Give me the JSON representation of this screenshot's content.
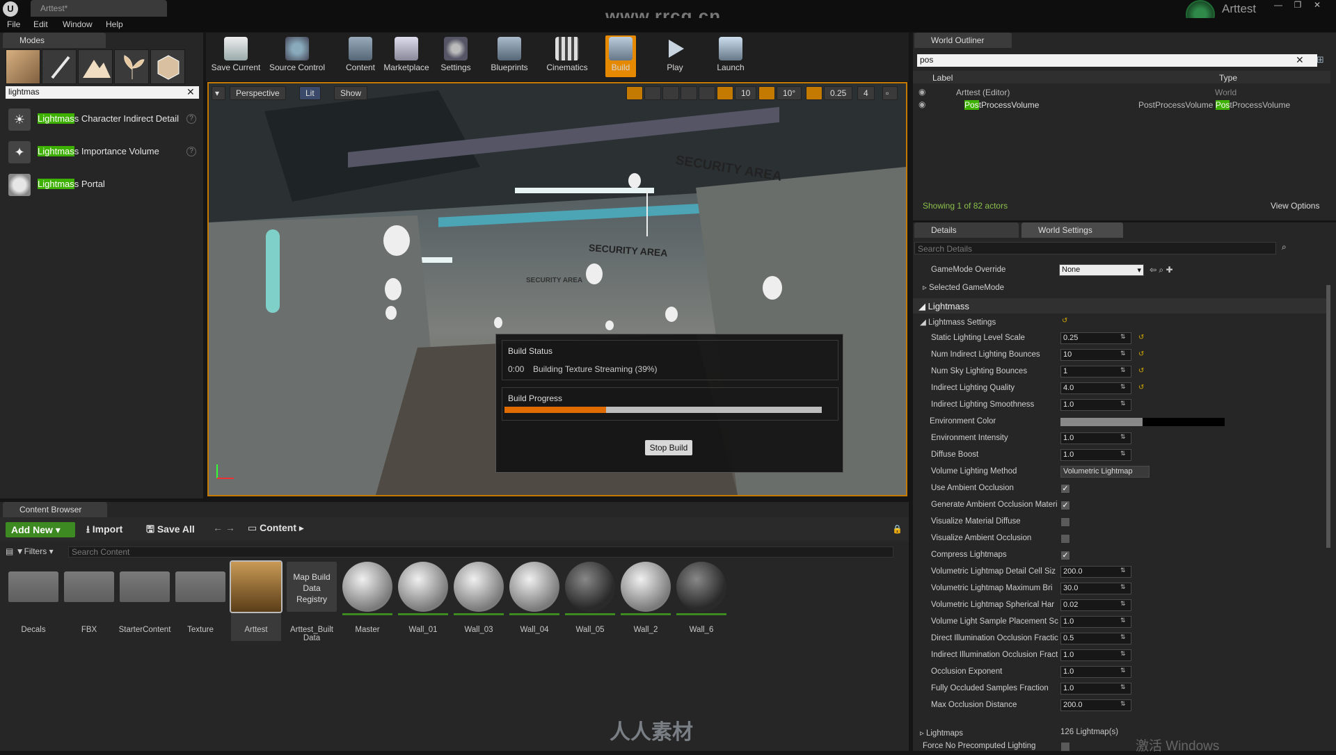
{
  "title_bar": {
    "tab_title": "Arttest*",
    "watermark_url": "www.rrcg.cn",
    "project_name": "Arttest"
  },
  "menu": [
    "File",
    "Edit",
    "Window",
    "Help"
  ],
  "modes": {
    "tab": "Modes",
    "search_value": "lightmas",
    "items": [
      {
        "match": "Lightmas",
        "rest": "s Character Indirect Detail"
      },
      {
        "match": "Lightmas",
        "rest": "s Importance Volume"
      },
      {
        "match": "Lightmas",
        "rest": "s Portal"
      }
    ]
  },
  "toolbar": {
    "buttons": [
      "Save Current",
      "Source Control",
      "Content",
      "Marketplace",
      "Settings",
      "Blueprints",
      "Cinematics",
      "Build",
      "Play",
      "Launch"
    ]
  },
  "viewport": {
    "perspective": "Perspective",
    "lit": "Lit",
    "show": "Show",
    "grid_snap": "10",
    "rot_snap": "10°",
    "scale_snap": "0.25",
    "cam_speed": "4",
    "signs": [
      "SECURITY AREA",
      "SECURITY AREA",
      "SECURITY AREA"
    ]
  },
  "build": {
    "status_title": "Build Status",
    "time": "0:00",
    "status_text": "Building Texture Streaming (39%)",
    "progress_title": "Build Progress",
    "progress": 0.32,
    "stop_label": "Stop Build"
  },
  "outliner": {
    "tab": "World Outliner",
    "search_value": "pos",
    "col_label": "Label",
    "col_type": "Type",
    "rows": [
      {
        "label": "Arttest (Editor)",
        "type": "World"
      },
      {
        "label_match": "Pos",
        "label_rest": "tProcessVolume",
        "type_prefix": "PostProcessVolume ",
        "type_match": "Pos",
        "type_rest": "tProcessVolume"
      }
    ],
    "status": "Showing 1 of 82 actors",
    "view_options": "View Options"
  },
  "details": {
    "tab_details": "Details",
    "tab_world": "World Settings",
    "search_placeholder": "Search Details",
    "gamemode_label": "GameMode Override",
    "gamemode_value": "None",
    "selected_gamemode": "Selected GameMode",
    "section_lightmass": "Lightmass",
    "lightmass_settings": "Lightmass Settings",
    "props": [
      {
        "label": "Static Lighting Level Scale",
        "value": "0.25"
      },
      {
        "label": "Num Indirect Lighting Bounces",
        "value": "10"
      },
      {
        "label": "Num Sky Lighting Bounces",
        "value": "1"
      },
      {
        "label": "Indirect Lighting Quality",
        "value": "4.0"
      },
      {
        "label": "Indirect Lighting Smoothness",
        "value": "1.0"
      },
      {
        "label": "Environment Color",
        "value": ""
      },
      {
        "label": "Environment Intensity",
        "value": "1.0"
      },
      {
        "label": "Diffuse Boost",
        "value": "1.0"
      },
      {
        "label": "Volume Lighting Method",
        "value": "Volumetric Lightmap"
      },
      {
        "label": "Use Ambient Occlusion",
        "checked": true
      },
      {
        "label": "Generate Ambient Occlusion Materi",
        "checked": true
      },
      {
        "label": "Visualize Material Diffuse",
        "checked": false
      },
      {
        "label": "Visualize Ambient Occlusion",
        "checked": false
      },
      {
        "label": "Compress Lightmaps",
        "checked": true
      },
      {
        "label": "Volumetric Lightmap Detail Cell Siz",
        "value": "200.0"
      },
      {
        "label": "Volumetric Lightmap Maximum Bri",
        "value": "30.0"
      },
      {
        "label": "Volumetric Lightmap Spherical Har",
        "value": "0.02"
      },
      {
        "label": "Volume Light Sample Placement Sc",
        "value": "1.0"
      },
      {
        "label": "Direct Illumination Occlusion Fractic",
        "value": "0.5"
      },
      {
        "label": "Indirect Illumination Occlusion Fract",
        "value": "1.0"
      },
      {
        "label": "Occlusion Exponent",
        "value": "1.0"
      },
      {
        "label": "Fully Occluded Samples Fraction",
        "value": "1.0"
      },
      {
        "label": "Max Occlusion Distance",
        "value": "200.0"
      }
    ],
    "lightmaps_label": "Lightmaps",
    "lightmaps_value": "126 Lightmap(s)",
    "force_label": "Force No Precomputed Lighting",
    "activate_windows": "激活 Windows"
  },
  "content_browser": {
    "tab": "Content Browser",
    "add_new": "Add New",
    "import": "Import",
    "save_all": "Save All",
    "path": "Content",
    "filters": "Filters",
    "search_placeholder": "Search Content",
    "assets": [
      "Decals",
      "FBX",
      "StarterContent",
      "Texture",
      "Arttest",
      "Map Build Data Registry",
      "Master",
      "Wall_01",
      "Wall_03",
      "Wall_04",
      "Wall_05",
      "Wall_2",
      "Wall_6"
    ],
    "asset_sub": "Arttest_Built Data"
  },
  "brand_watermark": "人人素材",
  "colors": {
    "accent": "#3eb000",
    "build_progress": "#e06b00",
    "viewport_border": "#c47a00",
    "link_green": "#8cc04c"
  }
}
